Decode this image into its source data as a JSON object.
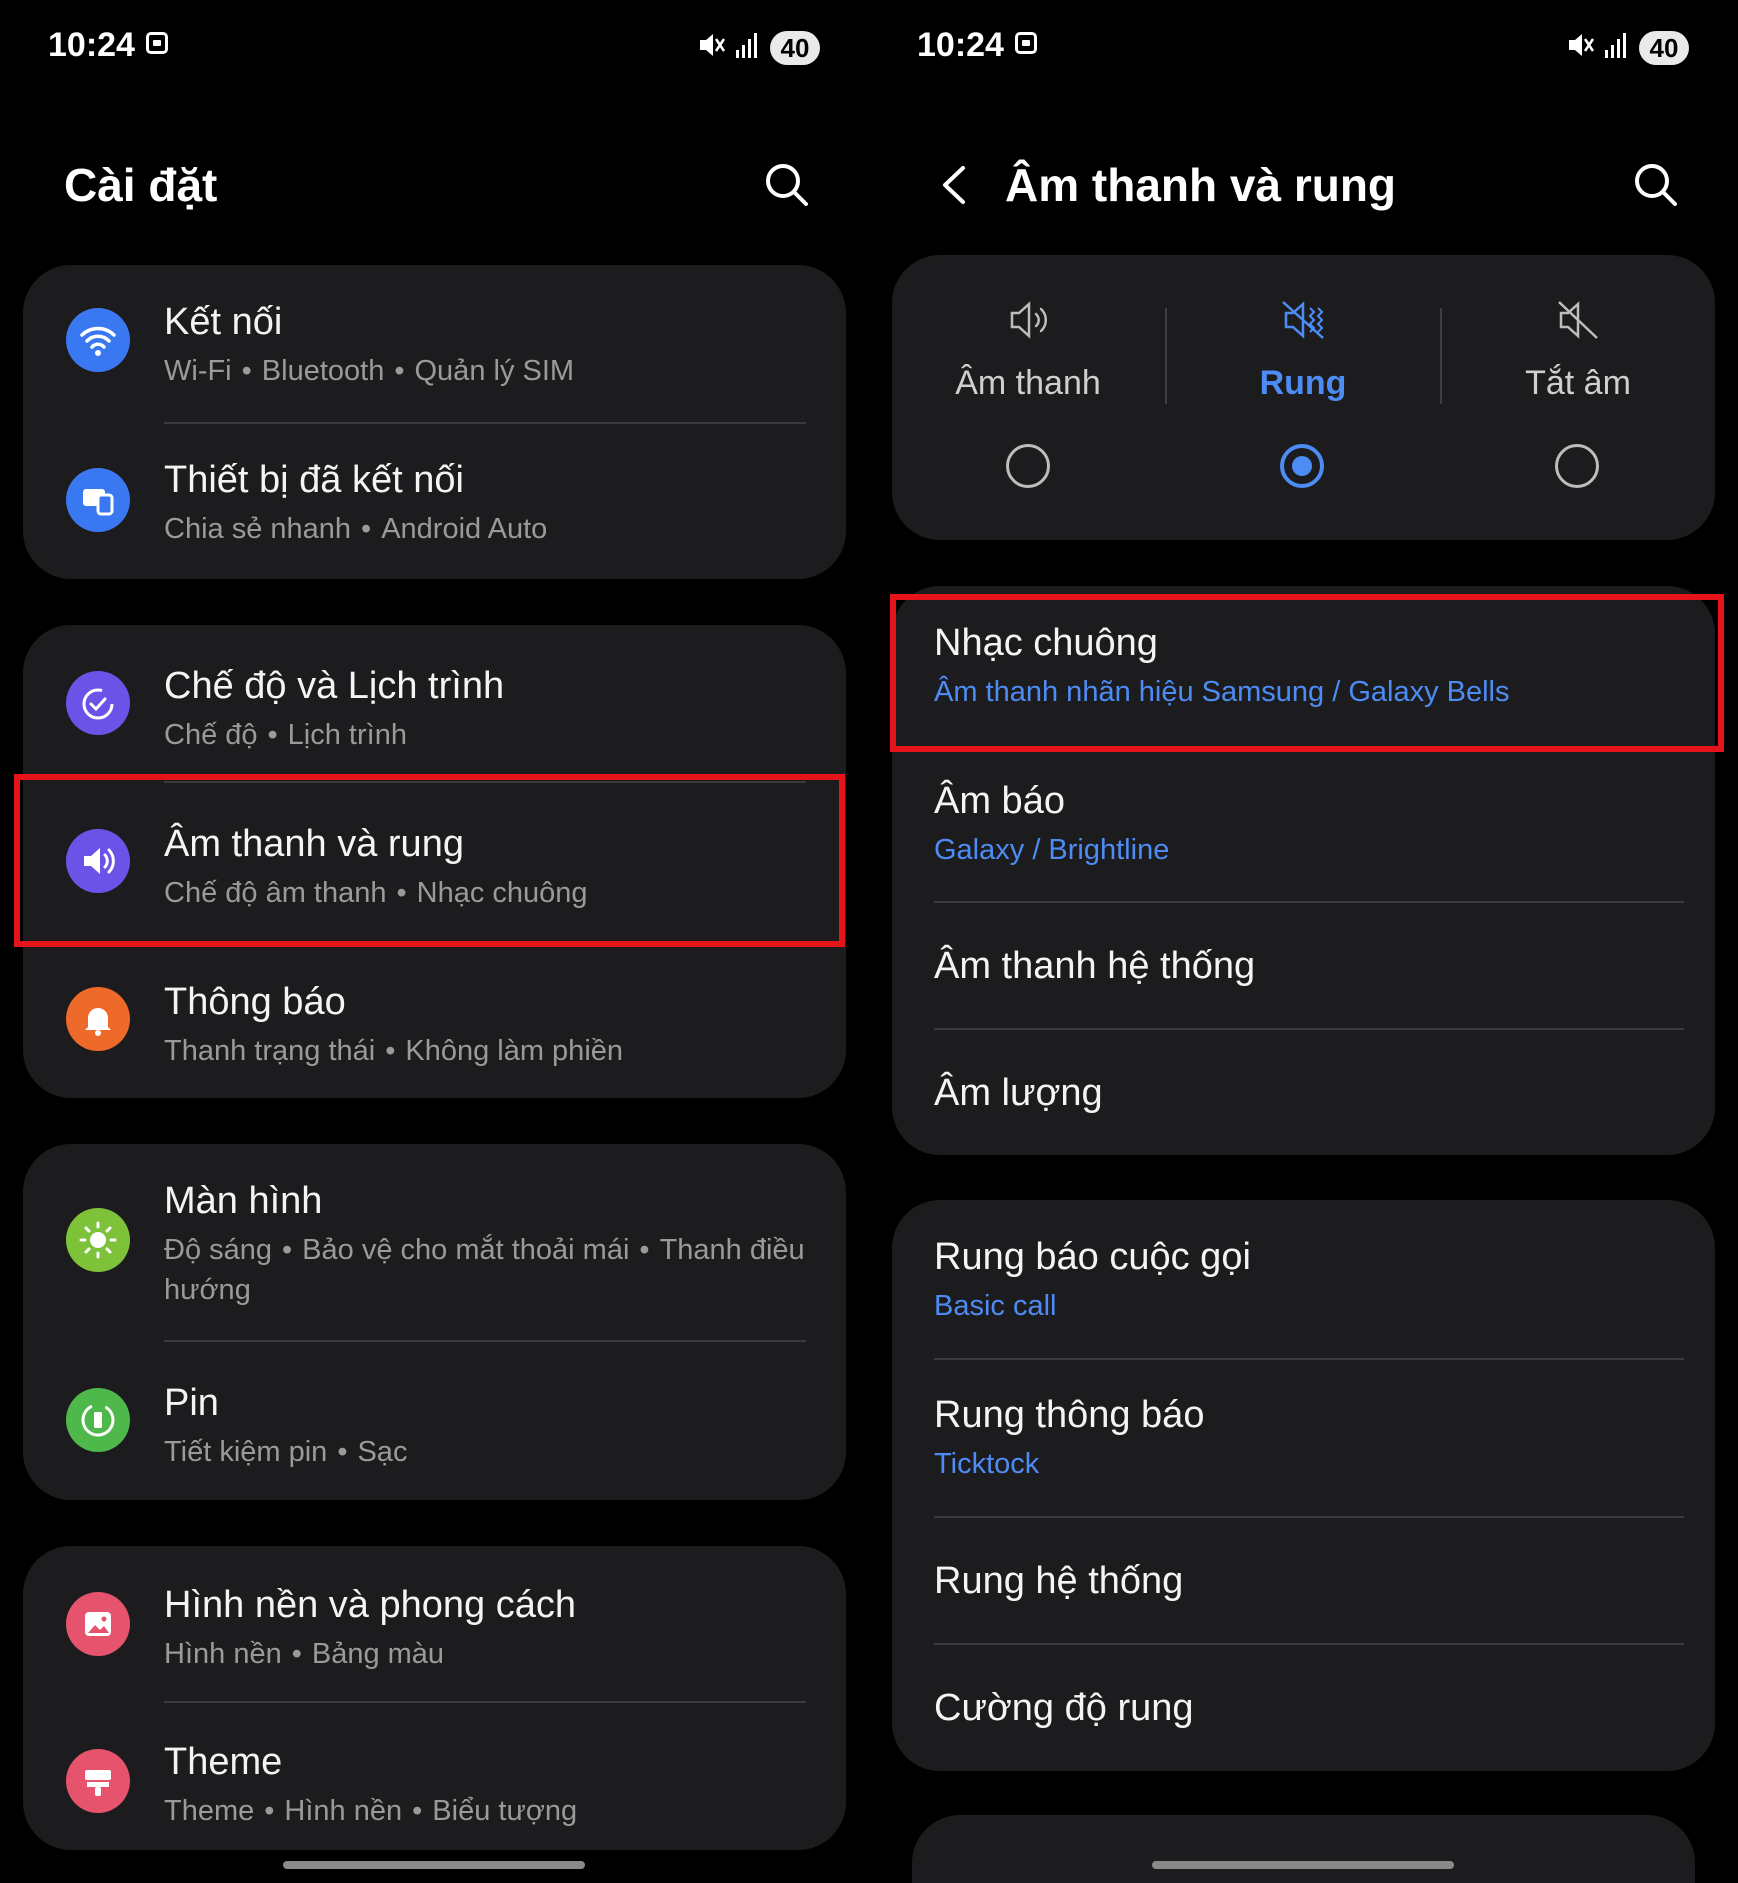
{
  "status_bar": {
    "time": "10:24",
    "battery": "40"
  },
  "left": {
    "title": "Cài đặt",
    "groups": [
      {
        "items": [
          {
            "title": "Kết nối",
            "sub": [
              "Wi-Fi",
              "Bluetooth",
              "Quản lý SIM"
            ]
          },
          {
            "title": "Thiết bị đã kết nối",
            "sub": [
              "Chia sẻ nhanh",
              "Android Auto"
            ]
          }
        ]
      },
      {
        "items": [
          {
            "title": "Chế độ và Lịch trình",
            "sub": [
              "Chế độ",
              "Lịch trình"
            ]
          },
          {
            "title": "Âm thanh và rung",
            "sub": [
              "Chế độ âm thanh",
              "Nhạc chuông"
            ]
          },
          {
            "title": "Thông báo",
            "sub": [
              "Thanh trạng thái",
              "Không làm phiền"
            ]
          }
        ]
      },
      {
        "items": [
          {
            "title": "Màn hình",
            "sub": [
              "Độ sáng",
              "Bảo vệ cho mắt thoải mái",
              "Thanh điều hướng"
            ]
          },
          {
            "title": "Pin",
            "sub": [
              "Tiết kiệm pin",
              "Sạc"
            ]
          }
        ]
      },
      {
        "items": [
          {
            "title": "Hình nền và phong cách",
            "sub": [
              "Hình nền",
              "Bảng màu"
            ]
          },
          {
            "title": "Theme",
            "sub": [
              "Theme",
              "Hình nền",
              "Biểu tượng"
            ]
          }
        ]
      }
    ],
    "icon_colors": {
      "connections": "#3a78f2",
      "devices": "#3a78f2",
      "modes": "#6b53e8",
      "sound": "#6b53e8",
      "notifications": "#ee6a2b",
      "display": "#7ec23a",
      "battery": "#4fb84a",
      "wallpaper": "#e5536c",
      "theme": "#e5536c"
    }
  },
  "right": {
    "title": "Âm thanh và rung",
    "modes": [
      {
        "label": "Âm thanh",
        "selected": false
      },
      {
        "label": "Rung",
        "selected": true
      },
      {
        "label": "Tắt âm",
        "selected": false
      }
    ],
    "group1": [
      {
        "title": "Nhạc chuông",
        "sub": "Âm thanh nhãn hiệu Samsung / Galaxy Bells"
      },
      {
        "title": "Âm báo",
        "sub": "Galaxy / Brightline"
      },
      {
        "title": "Âm thanh hệ thống"
      },
      {
        "title": "Âm lượng"
      }
    ],
    "group2": [
      {
        "title": "Rung báo cuộc gọi",
        "sub": "Basic call"
      },
      {
        "title": "Rung thông báo",
        "sub": "Ticktock"
      },
      {
        "title": "Rung hệ thống"
      },
      {
        "title": "Cường độ rung"
      }
    ]
  },
  "colors": {
    "accent": "#4d8cf5",
    "highlight": "#e5141b",
    "card": "#1c1c1e"
  }
}
